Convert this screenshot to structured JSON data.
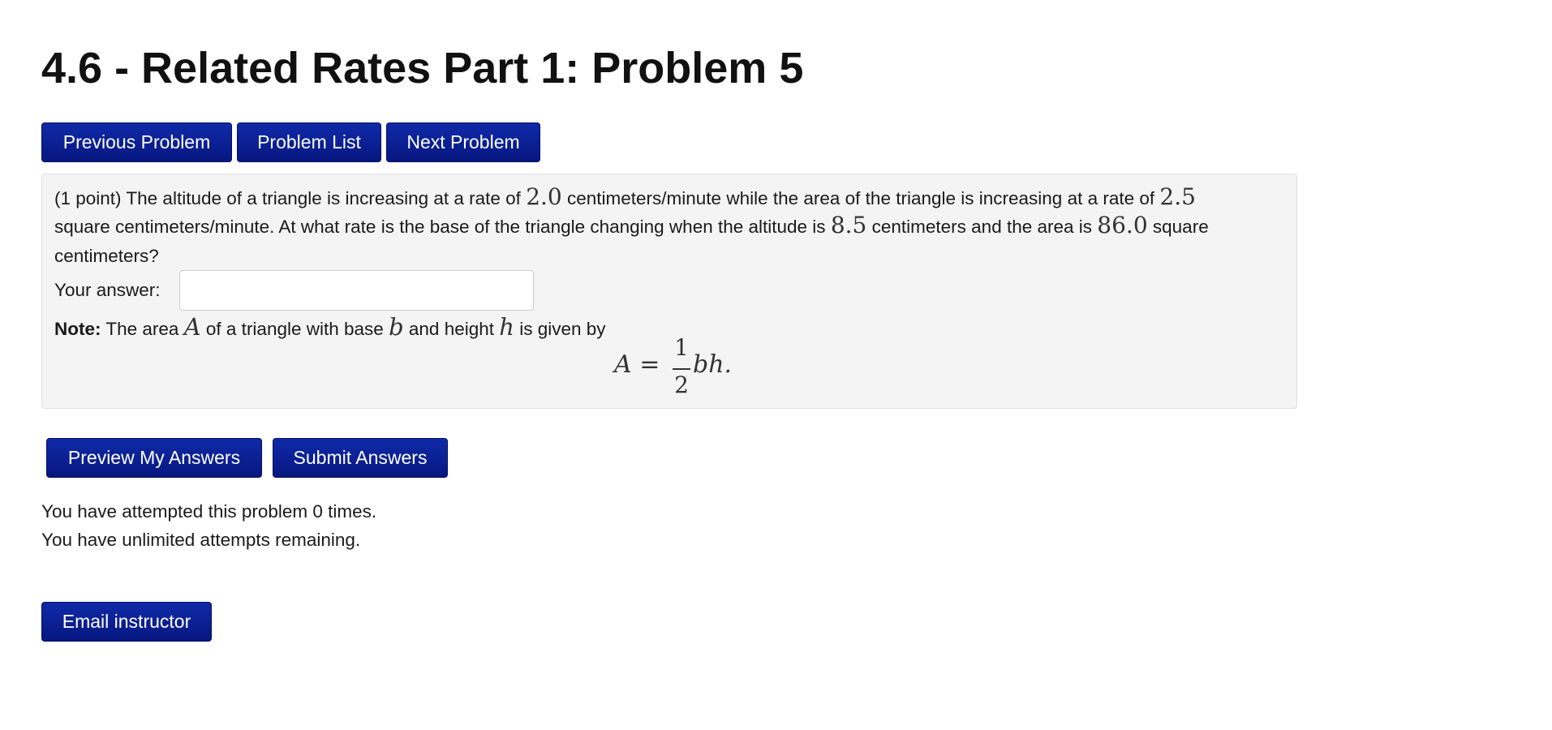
{
  "header": {
    "title": "4.6 - Related Rates Part 1: Problem 5"
  },
  "nav": {
    "previous_label": "Previous Problem",
    "list_label": "Problem List",
    "next_label": "Next Problem"
  },
  "problem": {
    "points": "(1 point)",
    "line1_a": "The altitude of a triangle is increasing at a rate of",
    "value_altitude_rate": "2.0",
    "line1_b": "centimeters/minute while the area of the triangle is increasing at a rate of",
    "value_area_rate": "2.5",
    "line2_a": "square centimeters/minute. At what rate is the base of the triangle changing when the altitude is",
    "value_altitude": "8.5",
    "line2_b": "centimeters and the area is",
    "value_area": "86.0",
    "line2_c": "square",
    "line3": "centimeters?",
    "answer_label": "Your answer:",
    "answer_value": "",
    "note_label": "Note:",
    "note_a": "The area",
    "var_A": "A",
    "note_b": "of a triangle with base",
    "var_b": "b",
    "note_c": "and height",
    "var_h": "h",
    "note_d": "is given by",
    "formula_lhs": "A =",
    "formula_num": "1",
    "formula_den": "2",
    "formula_rhs": "bh."
  },
  "actions": {
    "preview_label": "Preview My Answers",
    "submit_label": "Submit Answers"
  },
  "status": {
    "attempts": "You have attempted this problem 0 times.",
    "remaining": "You have unlimited attempts remaining."
  },
  "footer": {
    "email_label": "Email instructor"
  },
  "colors": {
    "button_bg": "#0a1e8c",
    "panel_bg": "#f4f4f4"
  }
}
